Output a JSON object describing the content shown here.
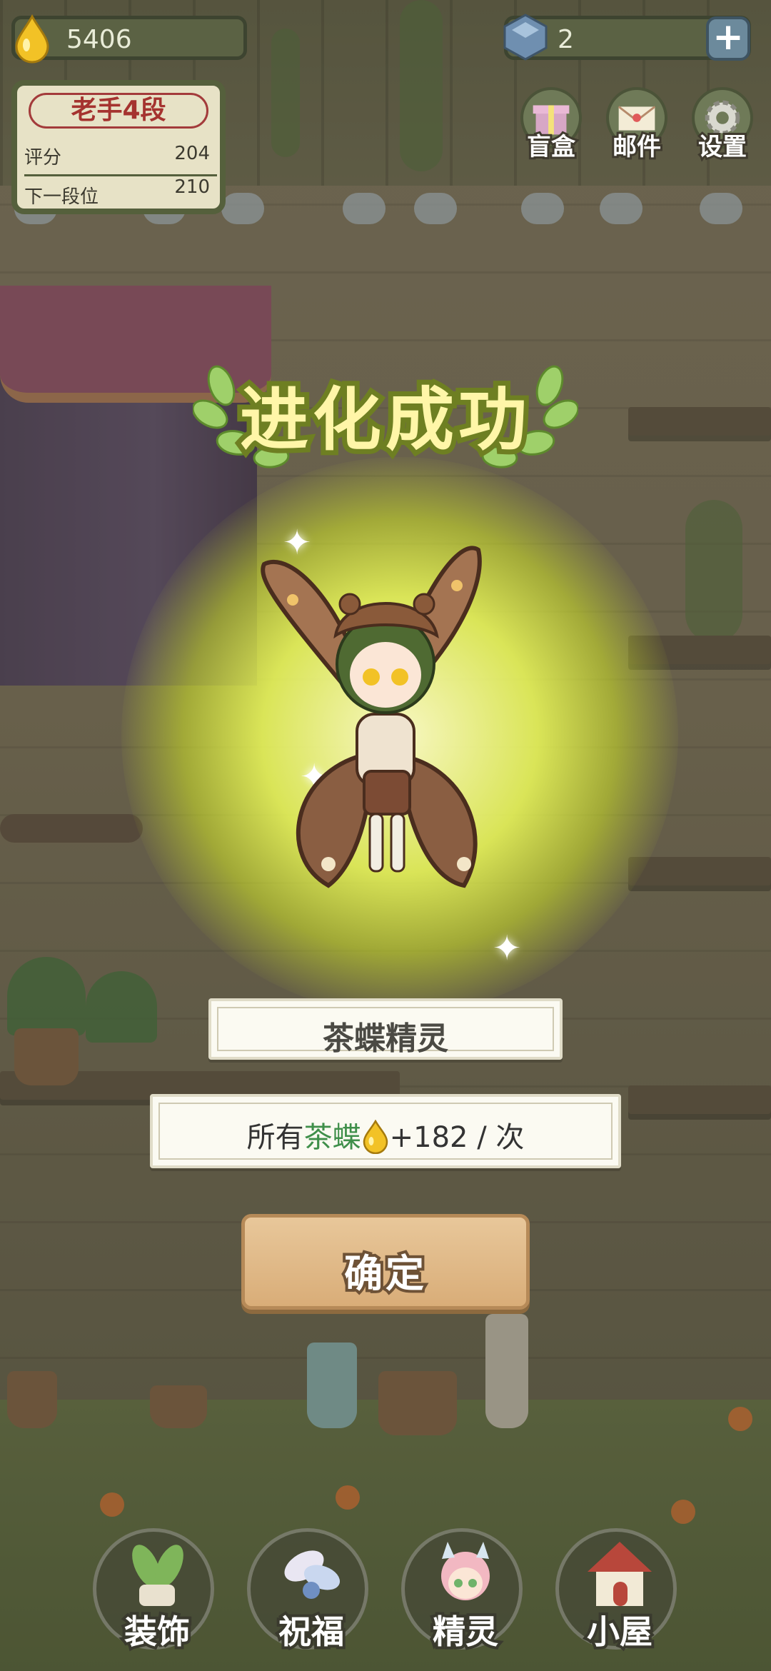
{
  "hud": {
    "currency_amount": "5406",
    "gem_amount": "2",
    "plus_symbol": "+"
  },
  "rank": {
    "title": "老手4段",
    "score_label": "评分",
    "score_value": "204",
    "next_label": "下一段位",
    "next_value": "210"
  },
  "top_buttons": [
    {
      "label": "盲盒",
      "icon": "gift-box-icon"
    },
    {
      "label": "邮件",
      "icon": "mail-icon"
    },
    {
      "label": "设置",
      "icon": "gear-icon"
    }
  ],
  "modal": {
    "title": "进化成功",
    "spirit_name": "茶蝶精灵",
    "reward_prefix": "所有",
    "reward_highlight": "茶蝶",
    "reward_suffix": "+182 / 次",
    "confirm_label": "确定"
  },
  "bottom_nav": [
    {
      "label": "装饰",
      "icon": "plant-pot-icon"
    },
    {
      "label": "祝福",
      "icon": "blessing-icon"
    },
    {
      "label": "精灵",
      "icon": "spirit-icon"
    },
    {
      "label": "小屋",
      "icon": "house-icon"
    }
  ],
  "colors": {
    "glow": "#eefc5a",
    "title_fill": "#fff6a8",
    "title_stroke": "#6e7f22",
    "highlight_green": "#3f8f4a",
    "rank_red": "#a5332f"
  }
}
